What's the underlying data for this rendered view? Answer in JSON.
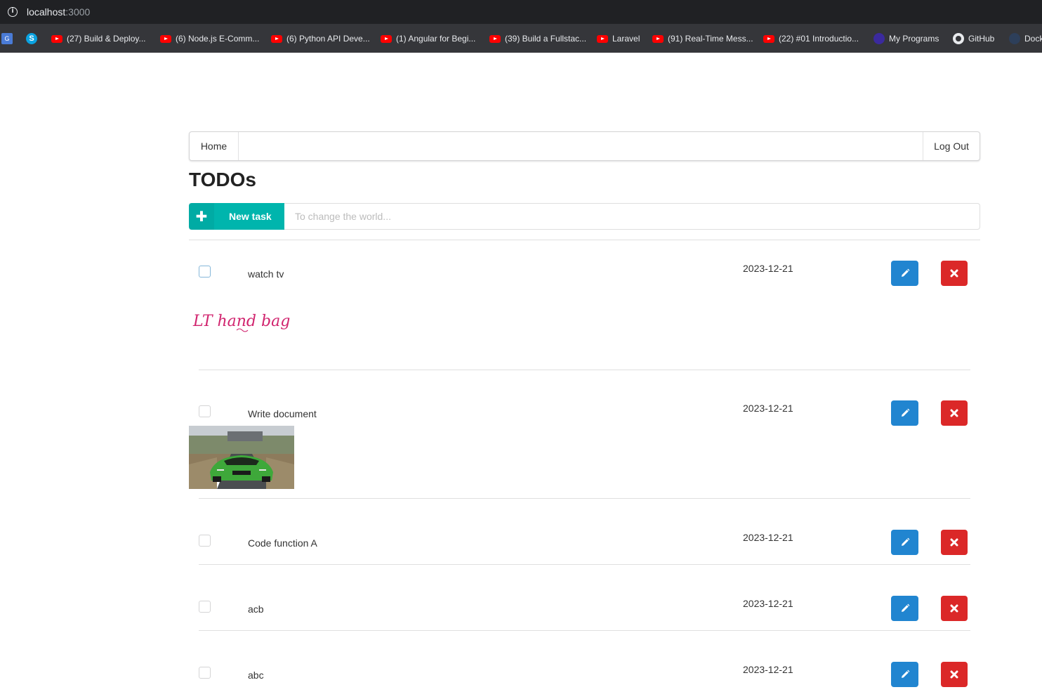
{
  "browser": {
    "url_host": "localhost",
    "url_port": ":3000",
    "bookmarks": [
      {
        "icon": "google-translate-icon",
        "label": ""
      },
      {
        "icon": "skype-icon",
        "label": ""
      },
      {
        "icon": "youtube-icon",
        "label": "(27) Build & Deploy..."
      },
      {
        "icon": "youtube-icon",
        "label": "(6) Node.js E-Comm..."
      },
      {
        "icon": "youtube-icon",
        "label": "(6) Python API Deve..."
      },
      {
        "icon": "youtube-icon",
        "label": "(1) Angular for Begi..."
      },
      {
        "icon": "youtube-icon",
        "label": "(39) Build a Fullstac..."
      },
      {
        "icon": "youtube-icon",
        "label": "Laravel"
      },
      {
        "icon": "youtube-icon",
        "label": "(91) Real-Time Mess..."
      },
      {
        "icon": "youtube-icon",
        "label": "(22) #01 Introductio..."
      },
      {
        "icon": "programs-icon",
        "label": "My Programs"
      },
      {
        "icon": "github-icon",
        "label": "GitHub"
      },
      {
        "icon": "docker-icon",
        "label": "Dock"
      }
    ]
  },
  "nav": {
    "home": "Home",
    "logout": "Log Out"
  },
  "page": {
    "title": "TODOs"
  },
  "new_task": {
    "button_label": "New task",
    "placeholder": "To change the world..."
  },
  "colors": {
    "teal": "#00b5ad",
    "blue": "#2185d0",
    "red": "#db2828"
  },
  "todos": [
    {
      "title": "watch tv",
      "date": "2023-12-21",
      "image": "LT hand bag"
    },
    {
      "title": "Write document",
      "date": "2023-12-21",
      "image": "car-photo"
    },
    {
      "title": "Code function A",
      "date": "2023-12-21"
    },
    {
      "title": "acb",
      "date": "2023-12-21"
    },
    {
      "title": "abc",
      "date": "2023-12-21"
    }
  ]
}
